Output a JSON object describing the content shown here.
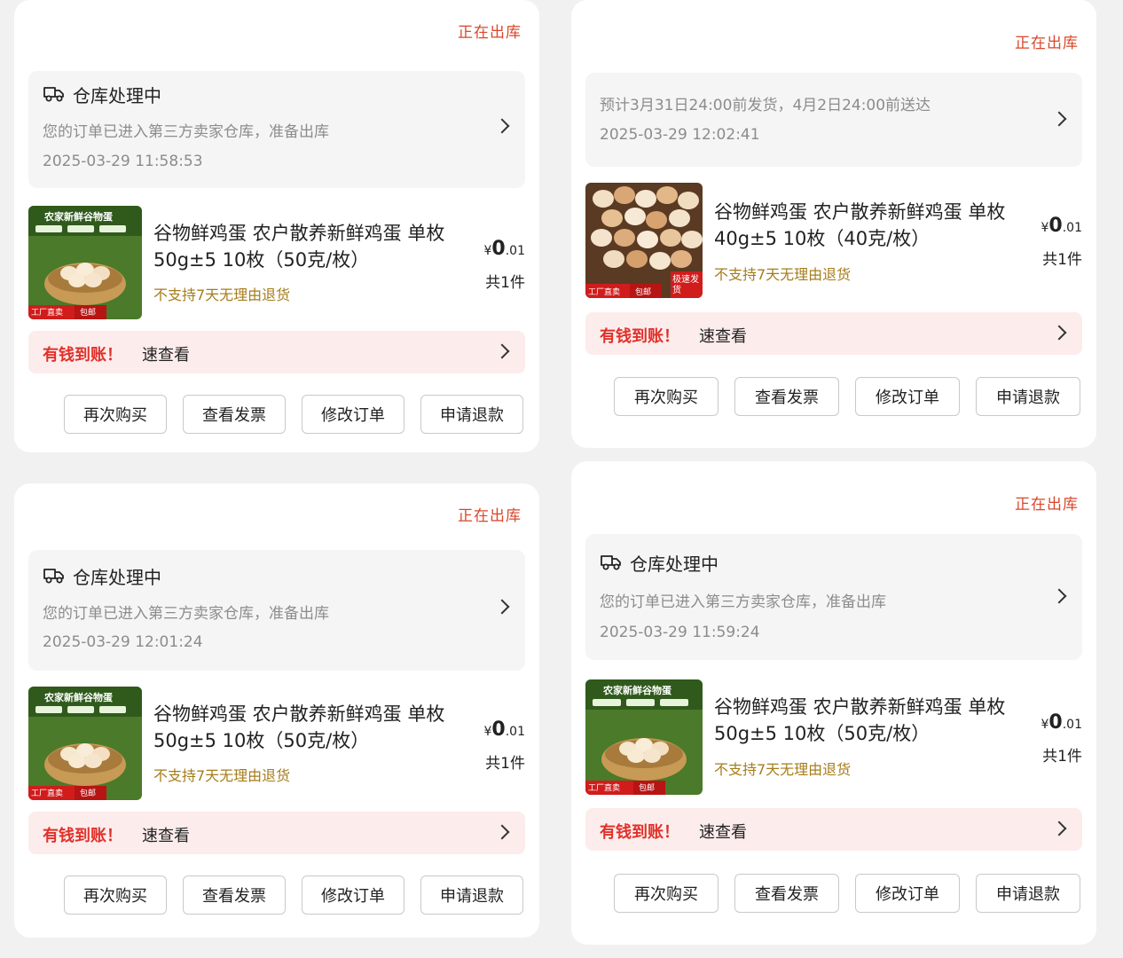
{
  "colors": {
    "status_red": "#d9472b",
    "money_red": "#e0312a",
    "money_bg": "#fdecec",
    "no_return_gold": "#a67c1a",
    "logistics_bg": "#f5f5f5"
  },
  "orders": [
    {
      "status": "正在出库",
      "logistics": {
        "icon": "truck-icon",
        "title": "仓库处理中",
        "description": "您的订单已进入第三方卖家仓库，准备出库",
        "time": "2025-03-29 11:58:53"
      },
      "product": {
        "image_text": "农家新鲜谷物蛋",
        "badge_left": "工厂直卖",
        "badge_right": "包邮",
        "title": "谷物鲜鸡蛋 农户散养新鲜鸡蛋 单枚50g±5 10枚（50克/枚）",
        "no_return": "不支持7天无理由退货",
        "price_symbol": "¥",
        "price_int": "0",
        "price_dec": ".01",
        "quantity": "共1件"
      },
      "money": {
        "highlight": "有钱到账！",
        "text": "速查看"
      },
      "buttons": [
        "再次购买",
        "查看发票",
        "修改订单",
        "申请退款"
      ]
    },
    {
      "status": "正在出库",
      "logistics": {
        "description": "预计3月31日24:00前发货，4月2日24:00前送达",
        "time": "2025-03-29 12:02:41"
      },
      "product": {
        "image_text": "",
        "badge_left": "工厂直卖",
        "badge_right": "包邮",
        "badge_corner": "极速发货",
        "title": "谷物鲜鸡蛋 农户散养新鲜鸡蛋 单枚40g±5 10枚（40克/枚）",
        "no_return": "不支持7天无理由退货",
        "price_symbol": "¥",
        "price_int": "0",
        "price_dec": ".01",
        "quantity": "共1件"
      },
      "money": {
        "highlight": "有钱到账！",
        "text": "速查看"
      },
      "buttons": [
        "再次购买",
        "查看发票",
        "修改订单",
        "申请退款"
      ]
    },
    {
      "status": "正在出库",
      "logistics": {
        "icon": "truck-icon",
        "title": "仓库处理中",
        "description": "您的订单已进入第三方卖家仓库，准备出库",
        "time": "2025-03-29 12:01:24"
      },
      "product": {
        "image_text": "农家新鲜谷物蛋",
        "badge_left": "工厂直卖",
        "badge_right": "包邮",
        "title": "谷物鲜鸡蛋 农户散养新鲜鸡蛋 单枚50g±5 10枚（50克/枚）",
        "no_return": "不支持7天无理由退货",
        "price_symbol": "¥",
        "price_int": "0",
        "price_dec": ".01",
        "quantity": "共1件"
      },
      "money": {
        "highlight": "有钱到账！",
        "text": "速查看"
      },
      "buttons": [
        "再次购买",
        "查看发票",
        "修改订单",
        "申请退款"
      ]
    },
    {
      "status": "正在出库",
      "logistics": {
        "icon": "truck-icon",
        "title": "仓库处理中",
        "description": "您的订单已进入第三方卖家仓库，准备出库",
        "time": "2025-03-29 11:59:24"
      },
      "product": {
        "image_text": "农家新鲜谷物蛋",
        "badge_left": "工厂直卖",
        "badge_right": "包邮",
        "title": "谷物鲜鸡蛋 农户散养新鲜鸡蛋 单枚50g±5 10枚（50克/枚）",
        "no_return": "不支持7天无理由退货",
        "price_symbol": "¥",
        "price_int": "0",
        "price_dec": ".01",
        "quantity": "共1件"
      },
      "money": {
        "highlight": "有钱到账！",
        "text": "速查看"
      },
      "buttons": [
        "再次购买",
        "查看发票",
        "修改订单",
        "申请退款"
      ]
    }
  ]
}
